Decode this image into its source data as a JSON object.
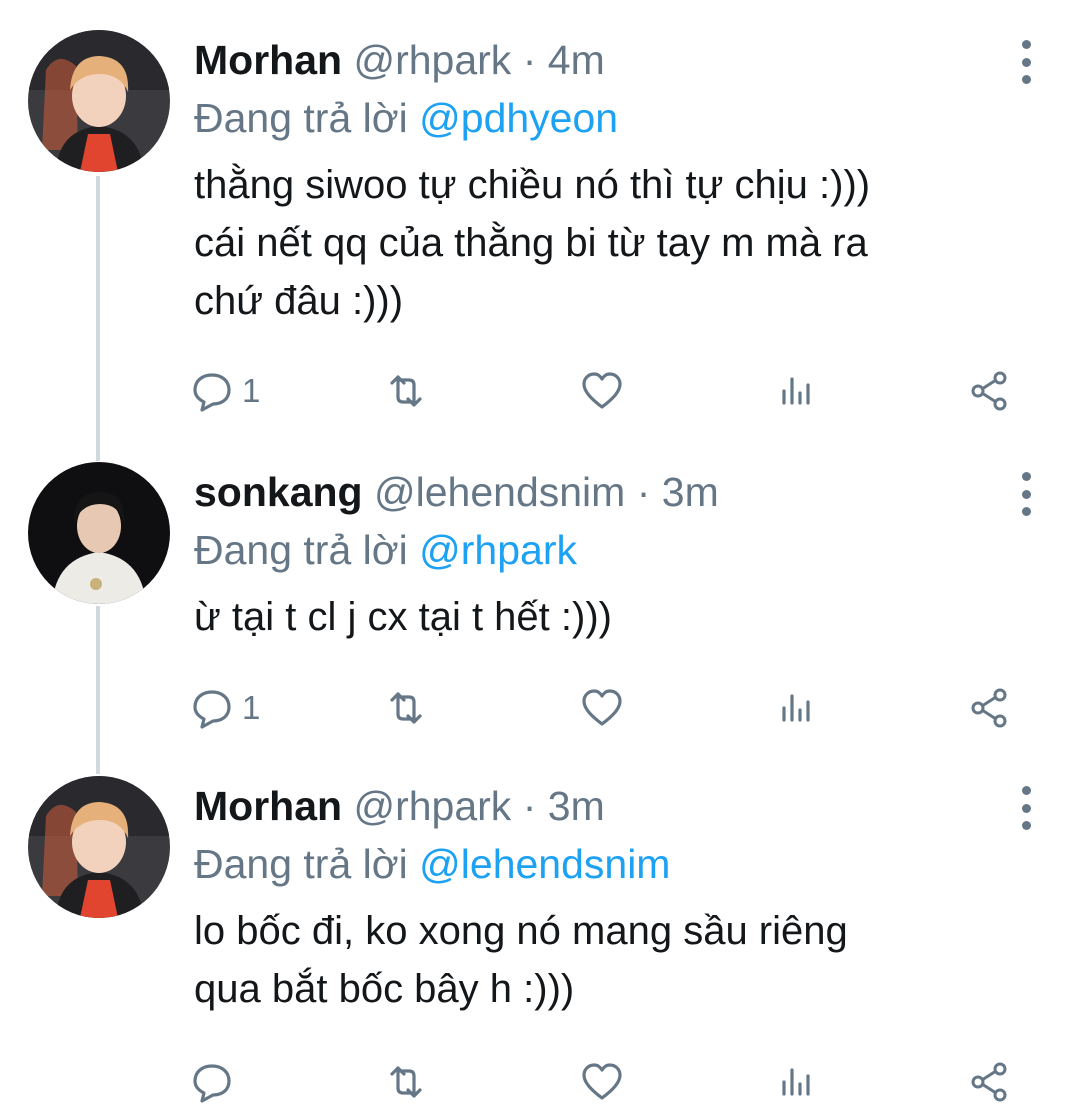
{
  "tweets": [
    {
      "name": "Morhan",
      "handle": "@rhpark",
      "separator": "·",
      "time": "4m",
      "reply_prefix": "Đang trả lời",
      "reply_to": "@pdhyeon",
      "lines": [
        "thằng siwoo tự chiều nó thì tự chịu :)))",
        "cái nết qq của thằng bi từ tay m mà ra",
        "chứ đâu :)))"
      ],
      "reply_count": "1",
      "avatar": "orange-hair-person-avatar"
    },
    {
      "name": "sonkang",
      "handle": "@lehendsnim",
      "separator": "·",
      "time": "3m",
      "reply_prefix": "Đang trả lời",
      "reply_to": "@rhpark",
      "lines": [
        "ừ tại t cl j cx tại t hết :)))"
      ],
      "reply_count": "1",
      "avatar": "dark-hair-person-avatar"
    },
    {
      "name": "Morhan",
      "handle": "@rhpark",
      "separator": "·",
      "time": "3m",
      "reply_prefix": "Đang trả lời",
      "reply_to": "@lehendsnim",
      "lines": [
        "lo bốc đi, ko xong nó mang sầu riêng",
        "qua bắt bốc bây h :)))"
      ],
      "reply_count": "",
      "avatar": "orange-hair-person-avatar"
    }
  ],
  "icons": {
    "reply": "reply-icon",
    "retweet": "retweet-icon",
    "like": "heart-icon",
    "analytics": "analytics-icon",
    "share": "share-icon",
    "more": "more-vertical-icon"
  },
  "colors": {
    "link": "#1da1f2",
    "secondary_text": "#657786",
    "thread_line": "#cfd9de"
  }
}
